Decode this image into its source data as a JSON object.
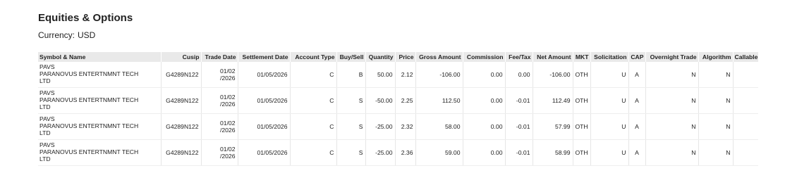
{
  "section": {
    "title": "Equities & Options",
    "currency_label": "Currency:",
    "currency_value": "USD"
  },
  "table": {
    "columns": [
      "Symbol & Name",
      "Cusip",
      "Trade Date",
      "Settlement Date",
      "Account Type",
      "Buy/Sell",
      "Quantity",
      "Price",
      "Gross Amount",
      "Commission",
      "Fee/Tax",
      "Net Amount",
      "MKT",
      "Solicitation",
      "CAP",
      "Overnight Trade",
      "Algorithm",
      "Callable"
    ],
    "rows": [
      {
        "symbol": "PAVS",
        "name_line1": "PARANOVUS ENTERTNMNT TECH",
        "name_line2": "LTD",
        "cusip": "G4289N122",
        "trade_date_line1": "01/02",
        "trade_date_line2": "/2026",
        "settlement_date": "01/05/2026",
        "account_type": "C",
        "buy_sell": "B",
        "quantity": "50.00",
        "price": "2.12",
        "gross_amount": "-106.00",
        "commission": "0.00",
        "fee_tax": "0.00",
        "net_amount": "-106.00",
        "mkt": "OTH",
        "solicitation": "U",
        "cap": "A",
        "overnight_trade": "N",
        "algorithm": "N",
        "callable": ""
      },
      {
        "symbol": "PAVS",
        "name_line1": "PARANOVUS ENTERTNMNT TECH",
        "name_line2": "LTD",
        "cusip": "G4289N122",
        "trade_date_line1": "01/02",
        "trade_date_line2": "/2026",
        "settlement_date": "01/05/2026",
        "account_type": "C",
        "buy_sell": "S",
        "quantity": "-50.00",
        "price": "2.25",
        "gross_amount": "112.50",
        "commission": "0.00",
        "fee_tax": "-0.01",
        "net_amount": "112.49",
        "mkt": "OTH",
        "solicitation": "U",
        "cap": "A",
        "overnight_trade": "N",
        "algorithm": "N",
        "callable": ""
      },
      {
        "symbol": "PAVS",
        "name_line1": "PARANOVUS ENTERTNMNT TECH",
        "name_line2": "LTD",
        "cusip": "G4289N122",
        "trade_date_line1": "01/02",
        "trade_date_line2": "/2026",
        "settlement_date": "01/05/2026",
        "account_type": "C",
        "buy_sell": "S",
        "quantity": "-25.00",
        "price": "2.32",
        "gross_amount": "58.00",
        "commission": "0.00",
        "fee_tax": "-0.01",
        "net_amount": "57.99",
        "mkt": "OTH",
        "solicitation": "U",
        "cap": "A",
        "overnight_trade": "N",
        "algorithm": "N",
        "callable": ""
      },
      {
        "symbol": "PAVS",
        "name_line1": "PARANOVUS ENTERTNMNT TECH",
        "name_line2": "LTD",
        "cusip": "G4289N122",
        "trade_date_line1": "01/02",
        "trade_date_line2": "/2026",
        "settlement_date": "01/05/2026",
        "account_type": "C",
        "buy_sell": "S",
        "quantity": "-25.00",
        "price": "2.36",
        "gross_amount": "59.00",
        "commission": "0.00",
        "fee_tax": "-0.01",
        "net_amount": "58.99",
        "mkt": "OTH",
        "solicitation": "U",
        "cap": "A",
        "overnight_trade": "N",
        "algorithm": "N",
        "callable": ""
      }
    ]
  }
}
